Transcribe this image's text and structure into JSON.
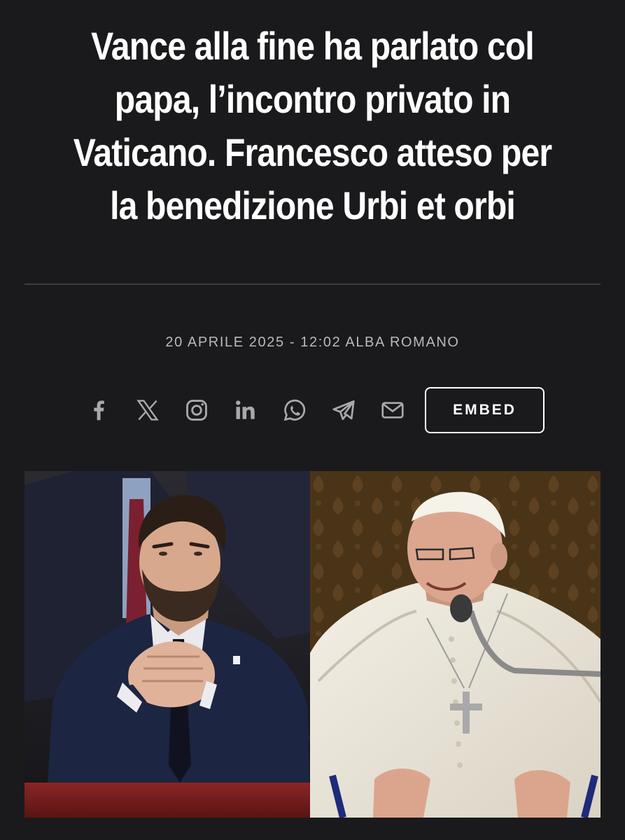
{
  "article": {
    "title": "Vance alla fine ha parlato col papa, l’incontro privato in Vaticano. Francesco atteso per la benedizione Urbi et orbi",
    "date": "20 APRILE 2025 - 12:02",
    "author": "ALBA ROMANO"
  },
  "share": {
    "icons": [
      "facebook-icon",
      "x-icon",
      "instagram-icon",
      "linkedin-icon",
      "whatsapp-icon",
      "telegram-icon",
      "mail-icon"
    ],
    "embed_label": "EMBED"
  },
  "colors": {
    "background": "#1a1a1c",
    "headline": "#ffffff",
    "byline": "#b9b9bd",
    "icons": "#a9a9ad",
    "divider": "#3e3e42"
  }
}
